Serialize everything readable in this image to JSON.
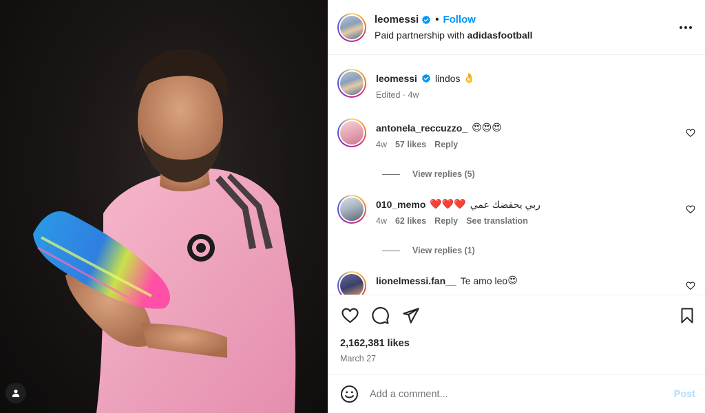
{
  "post": {
    "author": {
      "username": "leomessi",
      "verified": true,
      "follow_label": "Follow",
      "separator": "•",
      "partnership_prefix": "Paid partnership with",
      "partner": "adidasfootball"
    },
    "caption": {
      "username": "leomessi",
      "text": "lindos",
      "emoji": "👌",
      "meta": "Edited · 4w"
    },
    "comments": [
      {
        "username": "antonela_reccuzzo_",
        "text": "",
        "emoji": "😍😍😍",
        "time": "4w",
        "likes": "57 likes",
        "reply": "Reply",
        "view_replies": "View replies (5)"
      },
      {
        "username": "010_memo",
        "text": "ربي يحفضك عمي",
        "emoji": "❤️❤️❤️",
        "time": "4w",
        "likes": "62 likes",
        "reply": "Reply",
        "translation": "See translation",
        "view_replies": "View replies (1)"
      },
      {
        "username": "lionelmessi.fan__",
        "text": "Te amo leo",
        "emoji": "😍"
      }
    ],
    "likes": "2,162,381 likes",
    "date": "March 27",
    "add_comment": {
      "placeholder": "Add a comment...",
      "post_label": "Post"
    }
  },
  "colors": {
    "accent": "#0095f6",
    "verified": "#0095f6",
    "post_disabled": "#b3dbff",
    "secondary_text": "#737373",
    "jersey_pink": "#f2a7c1"
  },
  "icons": {
    "like": "heart-icon",
    "comment": "comment-icon",
    "share": "paper-plane-icon",
    "save": "bookmark-icon",
    "more": "more-horizontal-icon",
    "emoji": "smiley-icon",
    "tagged_user": "user-icon"
  }
}
